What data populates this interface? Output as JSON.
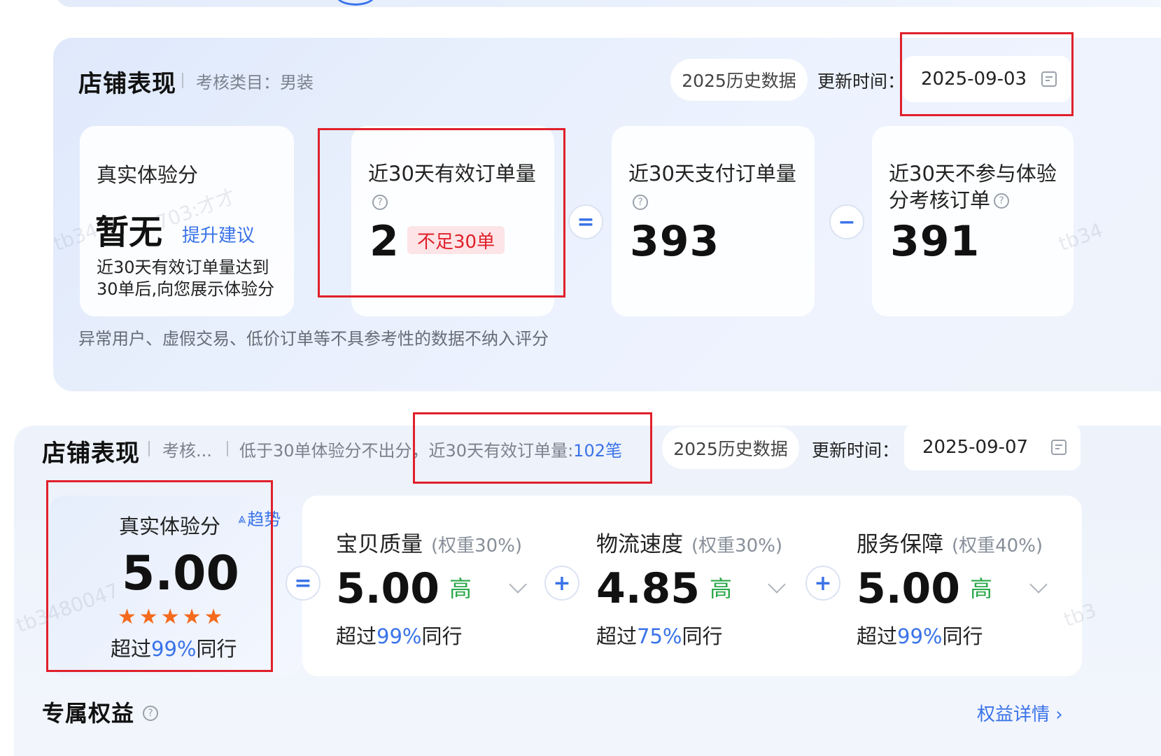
{
  "panel1": {
    "title": "店铺表现",
    "category": "考核类目：男装",
    "history_button": "2025历史数据",
    "update_label": "更新时间：",
    "update_date": "2025-09-03",
    "card_score": {
      "title": "真实体验分",
      "value": "暂无",
      "link": "提升建议",
      "note_line1": "近30天有效订单量达到",
      "note_line2": "30单后,向您展示体验分"
    },
    "card_valid": {
      "title": "近30天有效订单量",
      "value": "2",
      "badge": "不足30单"
    },
    "op_equals": "=",
    "card_paid": {
      "title": "近30天支付订单量",
      "value": "393"
    },
    "op_minus": "−",
    "card_excluded": {
      "title_line1": "近30天不参与体验",
      "title_line2": "分考核订单",
      "value": "391"
    },
    "footnote": "异常用户、虚假交易、低价订单等不具参考性的数据不纳入评分"
  },
  "panel2": {
    "title": "店铺表现",
    "category": "考核...",
    "notice_prefix": "低于30单体验分不出分，近30天有效订单量:",
    "notice_count": "102笔",
    "history_button": "2025历史数据",
    "update_label": "更新时间：",
    "update_date": "2025-09-07",
    "score": {
      "title": "真实体验分",
      "trend_link": "趋势",
      "value": "5.00",
      "rating": 5,
      "stars": "★★★★★",
      "exceed_prefix": "超过",
      "exceed_pct": "99%",
      "exceed_suffix": "同行"
    },
    "op_equals": "=",
    "op_plus": "+",
    "metrics": [
      {
        "name": "宝贝质量",
        "weight": "(权重30%)",
        "value": "5.00",
        "level": "高",
        "exceed_prefix": "超过",
        "exceed_pct": "99%",
        "exceed_suffix": "同行"
      },
      {
        "name": "物流速度",
        "weight": "(权重30%)",
        "value": "4.85",
        "level": "高",
        "exceed_prefix": "超过",
        "exceed_pct": "75%",
        "exceed_suffix": "同行"
      },
      {
        "name": "服务保障",
        "weight": "(权重40%)",
        "value": "5.00",
        "level": "高",
        "exceed_prefix": "超过",
        "exceed_pct": "99%",
        "exceed_suffix": "同行"
      }
    ]
  },
  "bottom": {
    "title": "专属权益",
    "link": "权益详情"
  },
  "watermarks": [
    "tb34",
    "703:才才",
    "tb3480047",
    "tb34",
    "tb3"
  ],
  "colors": {
    "accent": "#3a73e8",
    "highlight_red": "#e0202b",
    "level_green": "#2aa84a",
    "star_orange": "#f56a1d"
  }
}
